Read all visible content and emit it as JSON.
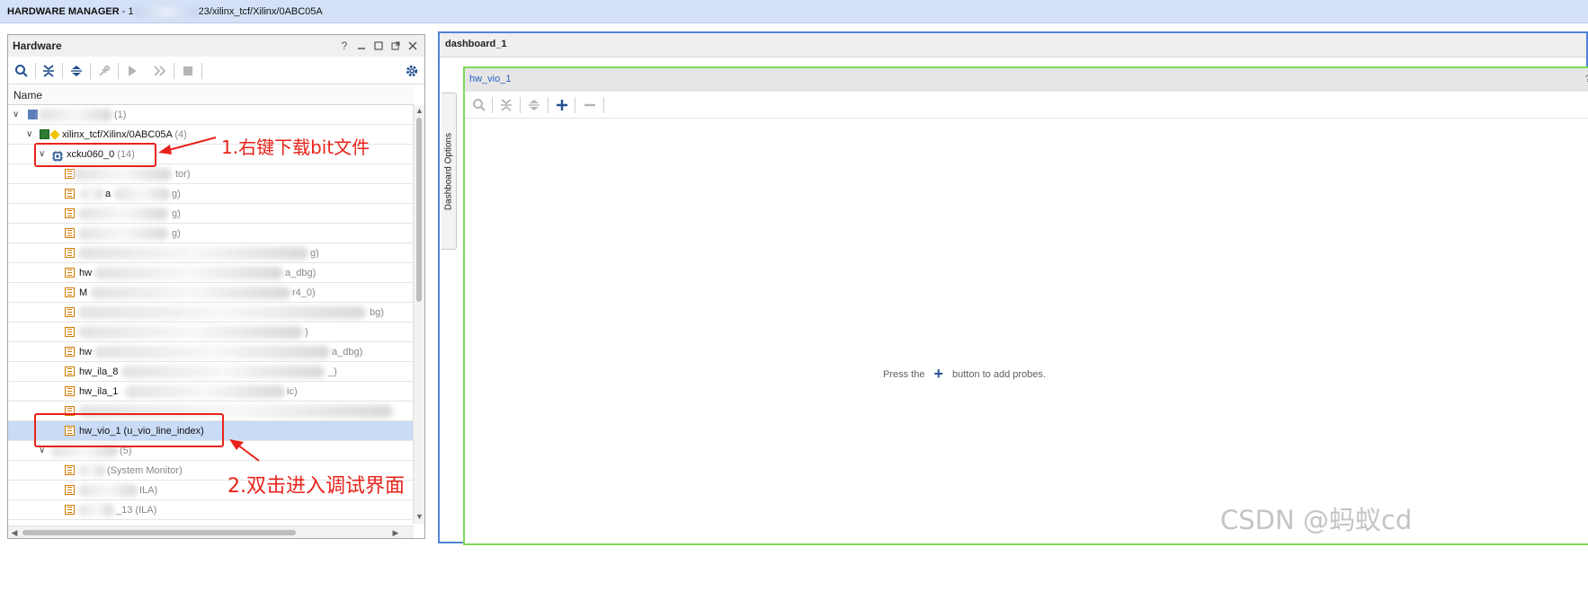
{
  "app": {
    "title_prefix": "HARDWARE MANAGER",
    "title_sep": " - 1",
    "title_suffix": "23/xilinx_tcf/Xilinx/0ABC05A"
  },
  "hardware": {
    "title": "Hardware",
    "help": "?",
    "column_name": "Name",
    "rows": [
      {
        "label": "",
        "count": "(1)"
      },
      {
        "label": "xilinx_tcf/Xilinx/0ABC05A",
        "count": "(4)"
      },
      {
        "label": "xcku060_0",
        "count": "(14)"
      },
      {
        "label": "",
        "count": "tor)"
      },
      {
        "label": "a",
        "count": "g)"
      },
      {
        "label": "",
        "count": "g)"
      },
      {
        "label": "",
        "count": "g)"
      },
      {
        "label": "",
        "count": "g)"
      },
      {
        "label": "hw",
        "count": "a_dbg)"
      },
      {
        "label": "M",
        "count": "r4_0)"
      },
      {
        "label": "",
        "count": "bg)"
      },
      {
        "label": "",
        "count": ")"
      },
      {
        "label": "hw",
        "count": "a_dbg)"
      },
      {
        "label": "hw_ila_8",
        "count": "_)"
      },
      {
        "label": "hw_ila_1",
        "count": "ic)"
      },
      {
        "label": "",
        "count": ""
      },
      {
        "label": "hw_vio_1 (u_vio_line_index)",
        "count": ""
      },
      {
        "label": "",
        "count": "(5)"
      },
      {
        "label": "",
        "count": "(System Monitor)"
      },
      {
        "label": "",
        "count": "ILA)"
      },
      {
        "label": "",
        "count": "_13 (ILA)"
      }
    ]
  },
  "annotations": {
    "step1": "1.右键下载bit文件",
    "step2": "2.双击进入调试界面"
  },
  "dashboard": {
    "tab": "dashboard_1",
    "side_tab": "Dashboard Options",
    "vio_title": "hw_vio_1",
    "help": "?",
    "empty_before": "Press the",
    "empty_after": "button to add probes."
  },
  "watermark": "CSDN @蚂蚁cd",
  "colors": {
    "accent_red": "#e8231b",
    "selection": "#c9dbf5",
    "panel_border_blue": "#4f84d8",
    "vio_border_green": "#7ed957"
  }
}
